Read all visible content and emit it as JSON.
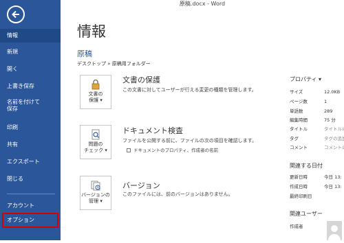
{
  "window": {
    "title": "原稿.docx - Word"
  },
  "sidebar": {
    "items": [
      {
        "label": "情報"
      },
      {
        "label": "新規"
      },
      {
        "label": "開く"
      },
      {
        "label": "上書き保存"
      },
      {
        "label": "名前を付けて保存"
      },
      {
        "label": "印刷"
      },
      {
        "label": "共有"
      },
      {
        "label": "エクスポート"
      },
      {
        "label": "閉じる"
      },
      {
        "label": "アカウント"
      },
      {
        "label": "オプション"
      }
    ],
    "colors": {
      "background": "#2b579a",
      "selected": "#1f4a86",
      "highlight": "#d40000"
    }
  },
  "main": {
    "heading": "情報",
    "doc_name": "原稿",
    "breadcrumb": "デスクトップ » 原稿用フォルダー",
    "sections": [
      {
        "button_label_line1": "文書の",
        "button_label_line2": "保護 ▾",
        "icon": "lock-icon",
        "title": "文書の保護",
        "desc": "この文書に対してユーザーが行える変更の種類を管理します。"
      },
      {
        "button_label_line1": "問題の",
        "button_label_line2": "チェック ▾",
        "icon": "inspect-document-icon",
        "title": "ドキュメント検査",
        "desc": "ファイルを公開する前に、ファイルの次の項目を確認します。",
        "bullet": "ドキュメントのプロパティ、作成者の名前"
      },
      {
        "button_label_line1": "バージョンの",
        "button_label_line2": "管理 ▾",
        "icon": "versions-icon",
        "title": "バージョン",
        "desc": "このファイルには、前のバージョンはありません。"
      }
    ]
  },
  "properties": {
    "title": "プロパティ ▾",
    "rows": [
      {
        "key": "サイズ",
        "value": "12.0KB"
      },
      {
        "key": "ページ数",
        "value": "1"
      },
      {
        "key": "単語数",
        "value": "289"
      },
      {
        "key": "編集時間",
        "value": "75 分"
      },
      {
        "key": "タイトル",
        "value": "タイトルの"
      },
      {
        "key": "タグ",
        "value": "タグの追加"
      },
      {
        "key": "コメント",
        "value": "コメントの"
      }
    ],
    "dates_title": "関連する日付",
    "dates": [
      {
        "key": "更新日時",
        "value": "今日 13:"
      },
      {
        "key": "作成日時",
        "value": "今日 13:"
      },
      {
        "key": "最終印刷日",
        "value": ""
      }
    ],
    "users_title": "関連ユーザー",
    "users": [
      {
        "key": "作成者",
        "value": ""
      }
    ]
  }
}
